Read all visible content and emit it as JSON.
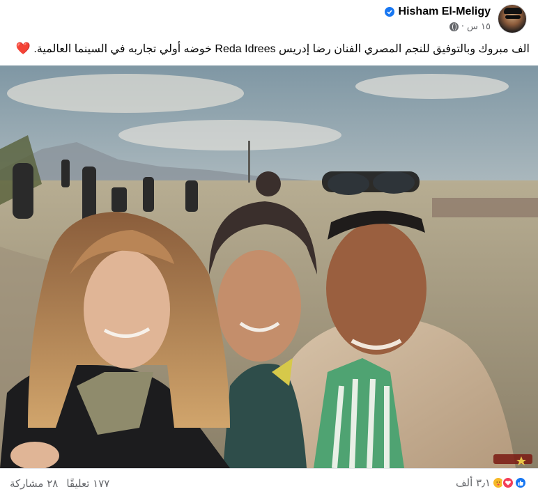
{
  "post": {
    "author": {
      "name": "Hisham El-Meligy",
      "verified": true
    },
    "meta": {
      "time": "١٥ س",
      "separator": "·",
      "audience_icon": "globe-icon"
    },
    "text": "الف مبروك وبالتوفيق للنجم المصري الفنان رضا إدريس Reda Idrees خوضه أولي تجاربه في السينما العالمية.",
    "text_emoji": "❤️"
  },
  "footer": {
    "reactions": {
      "icons": [
        "like-icon",
        "love-icon",
        "care-icon"
      ],
      "count": "٣٫١ ألف"
    },
    "comments": "١٧٧ تعليقًا",
    "shares": "٢٨ مشاركة"
  },
  "colors": {
    "accent": "#1877f2",
    "love": "#f33e58",
    "care": "#f7b928",
    "secondary_text": "#65676b"
  }
}
